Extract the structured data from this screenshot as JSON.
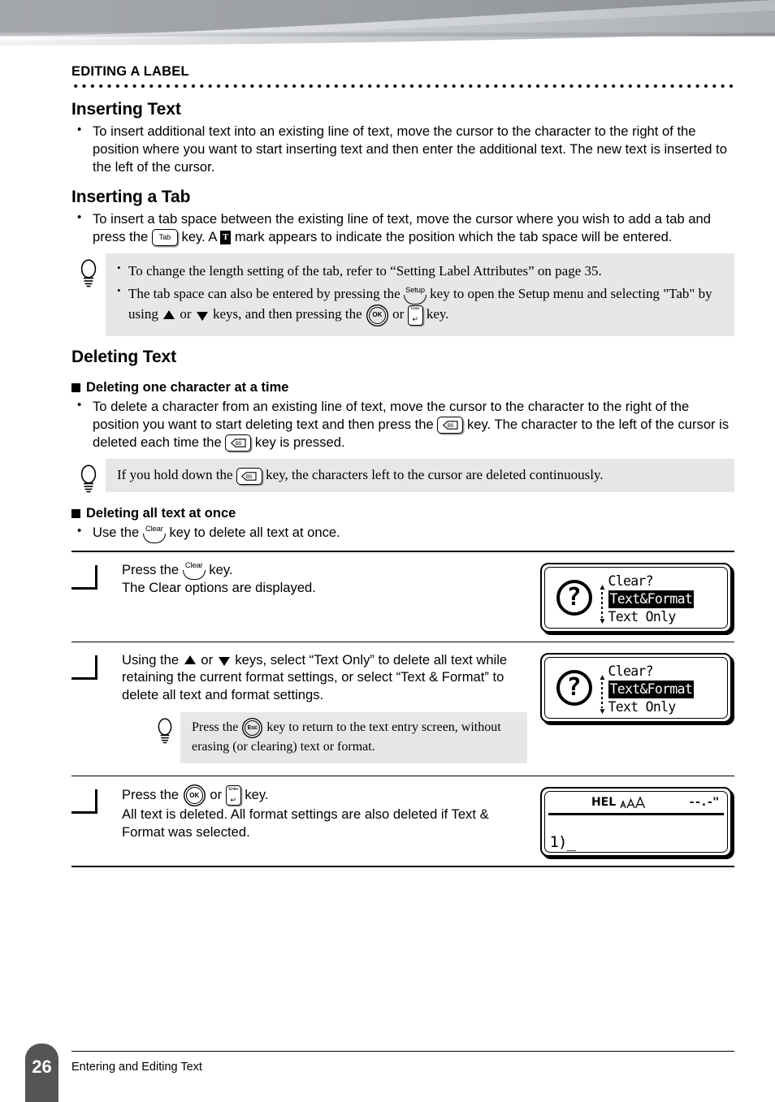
{
  "header": {
    "chapter_title": "EDITING A LABEL"
  },
  "sections": {
    "inserting_text": {
      "heading": "Inserting Text",
      "bullet": "To insert additional text into an existing line of text, move the cursor to the character to the right of the position where you want to start inserting text and then enter the additional text. The new text is inserted to the left of the cursor."
    },
    "inserting_tab": {
      "heading": "Inserting a Tab",
      "bullet_part1": "To insert a tab space between the existing line of text, move the cursor where you wish to add a tab and press the",
      "bullet_part2": "key. A",
      "bullet_part3": "mark appears to indicate the position which the tab space will be entered."
    },
    "tip_tab": {
      "item1": "To change the length setting of the tab, refer to “Setting Label Attributes” on page 35.",
      "item2_part1": "The tab space can also be entered by pressing the",
      "item2_part2": "key to open the Setup menu and selecting \"Tab\" by using",
      "item2_part3": "or",
      "item2_part4": "keys, and then pressing the",
      "item2_part5": "or",
      "item2_part6": "key."
    },
    "deleting_text": {
      "heading": "Deleting Text"
    },
    "deleting_one": {
      "heading": "Deleting one character at a time",
      "bullet_part1": "To delete a character from an existing line of text, move the cursor to the character to the right of the position you want to start deleting text and then press the",
      "bullet_part2": "key. The character to the left of the cursor is deleted each time the",
      "bullet_part3": "key is pressed."
    },
    "tip_hold": {
      "part1": "If you hold down the",
      "part2": "key, the characters left to the cursor are deleted continuously."
    },
    "deleting_all": {
      "heading": "Deleting all text at once",
      "bullet_part1": "Use the",
      "bullet_part2": "key to delete all text at once."
    }
  },
  "steps": [
    {
      "text_part1": "Press the",
      "text_part2": "key.",
      "text_line2": "The Clear options are displayed.",
      "screen": "clear_dialog"
    },
    {
      "text_part1": "Using the",
      "text_part2": "or",
      "text_part3": "keys, select “Text Only” to delete all text while retaining the current format settings, or select “Text & Format” to delete all text and format settings.",
      "tip_part1": "Press the",
      "tip_part2": "key to return to the text entry screen, without erasing (or clearing) text or format.",
      "screen": "clear_dialog"
    },
    {
      "text_part1": "Press the",
      "text_part2": "or",
      "text_part3": "key.",
      "text_line2": "All text is deleted. All format settings are also deleted if Text & Format was selected.",
      "screen": "text_entry"
    }
  ],
  "lcd": {
    "clear_dialog": {
      "icon": "question-mark",
      "icon_char": "?",
      "title": "Clear?",
      "option_selected": "Text&Format",
      "option_other": "Text Only"
    },
    "text_entry": {
      "font_label": "HEL",
      "length_label": "--.-\"",
      "line_content": "1)"
    }
  },
  "keys": {
    "tab": "Tab",
    "bs": "BS",
    "setup": "Setup",
    "clear": "Clear",
    "ok": "OK",
    "esc": "Esc",
    "enter": "Enter",
    "tab_mark": "T"
  },
  "footer": {
    "page_number": "26",
    "section_name": "Entering and Editing Text"
  },
  "colors": {
    "tip_background": "#e7e7e7",
    "page_tab": "#555555",
    "banner_dark": "#9a9da1",
    "banner_light": "#e9eaec"
  }
}
